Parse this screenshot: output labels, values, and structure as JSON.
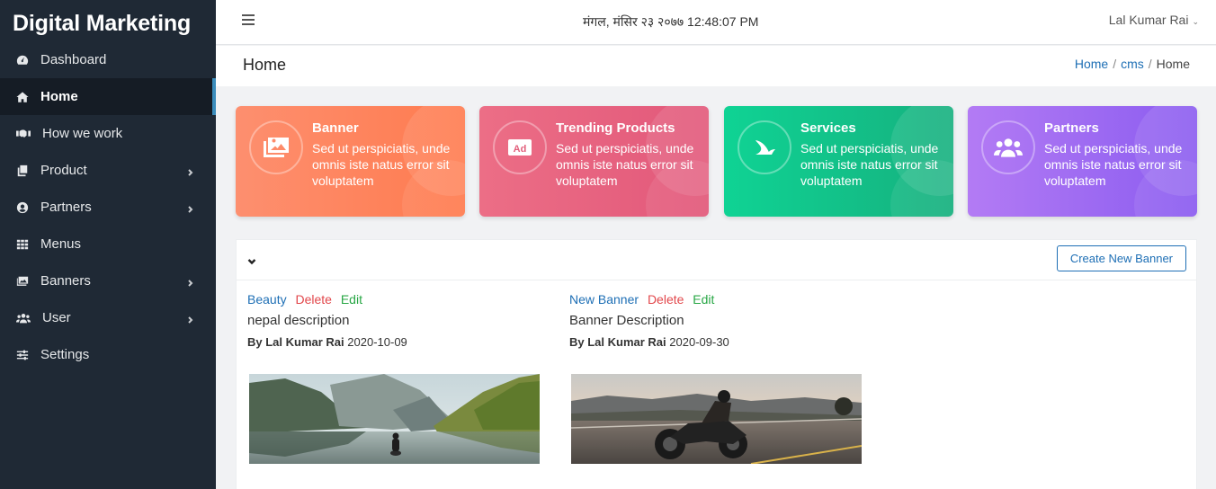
{
  "app": {
    "brand": "Digital Marketing"
  },
  "sidebar": {
    "items": [
      {
        "label": "Dashboard",
        "icon": "tachometer-icon",
        "active": false,
        "has_submenu": false
      },
      {
        "label": "Home",
        "icon": "home-icon",
        "active": true,
        "has_submenu": false
      },
      {
        "label": "How we work",
        "icon": "handshake-icon",
        "active": false,
        "has_submenu": false
      },
      {
        "label": "Product",
        "icon": "copy-icon",
        "active": false,
        "has_submenu": true
      },
      {
        "label": "Partners",
        "icon": "user-circle-icon",
        "active": false,
        "has_submenu": true
      },
      {
        "label": "Menus",
        "icon": "grid-icon",
        "active": false,
        "has_submenu": false
      },
      {
        "label": "Banners",
        "icon": "images-icon",
        "active": false,
        "has_submenu": true
      },
      {
        "label": "User",
        "icon": "users-icon",
        "active": false,
        "has_submenu": true
      },
      {
        "label": "Settings",
        "icon": "sliders-icon",
        "active": false,
        "has_submenu": false
      }
    ]
  },
  "topbar": {
    "datetime": "मंगल, मंसिर २३ २०७७ 12:48:07 PM",
    "user_name": "Lal Kumar Rai"
  },
  "page": {
    "title": "Home",
    "breadcrumb": [
      "Home",
      "cms",
      "Home"
    ]
  },
  "cards": [
    {
      "title": "Banner",
      "text": "Sed ut perspiciatis, unde omnis iste natus error sit voluptatem",
      "icon": "images-icon",
      "color": "#fe8660"
    },
    {
      "title": "Trending Products",
      "text": "Sed ut perspiciatis, unde omnis iste natus error sit voluptatem",
      "icon": "ad-icon",
      "color": "#e7637f"
    },
    {
      "title": "Services",
      "text": "Sed ut perspiciatis, unde omnis iste natus error sit voluptatem",
      "icon": "sail-icon",
      "color": "#12c289"
    },
    {
      "title": "Partners",
      "text": "Sed ut perspiciatis, unde omnis iste natus error sit voluptatem",
      "icon": "users-icon",
      "color": "#9e6bf2"
    }
  ],
  "panel": {
    "create_button": "Create New Banner",
    "banners": [
      {
        "title": "Beauty",
        "delete_label": "Delete",
        "edit_label": "Edit",
        "description": "nepal description",
        "by_label": "By Lal Kumar Rai",
        "date": "2020-10-09",
        "image": "mountain-lake-photo"
      },
      {
        "title": "New Banner",
        "delete_label": "Delete",
        "edit_label": "Edit",
        "description": "Banner Description",
        "by_label": "By Lal Kumar Rai",
        "date": "2020-09-30",
        "image": "motorcycle-rider-photo"
      }
    ]
  }
}
